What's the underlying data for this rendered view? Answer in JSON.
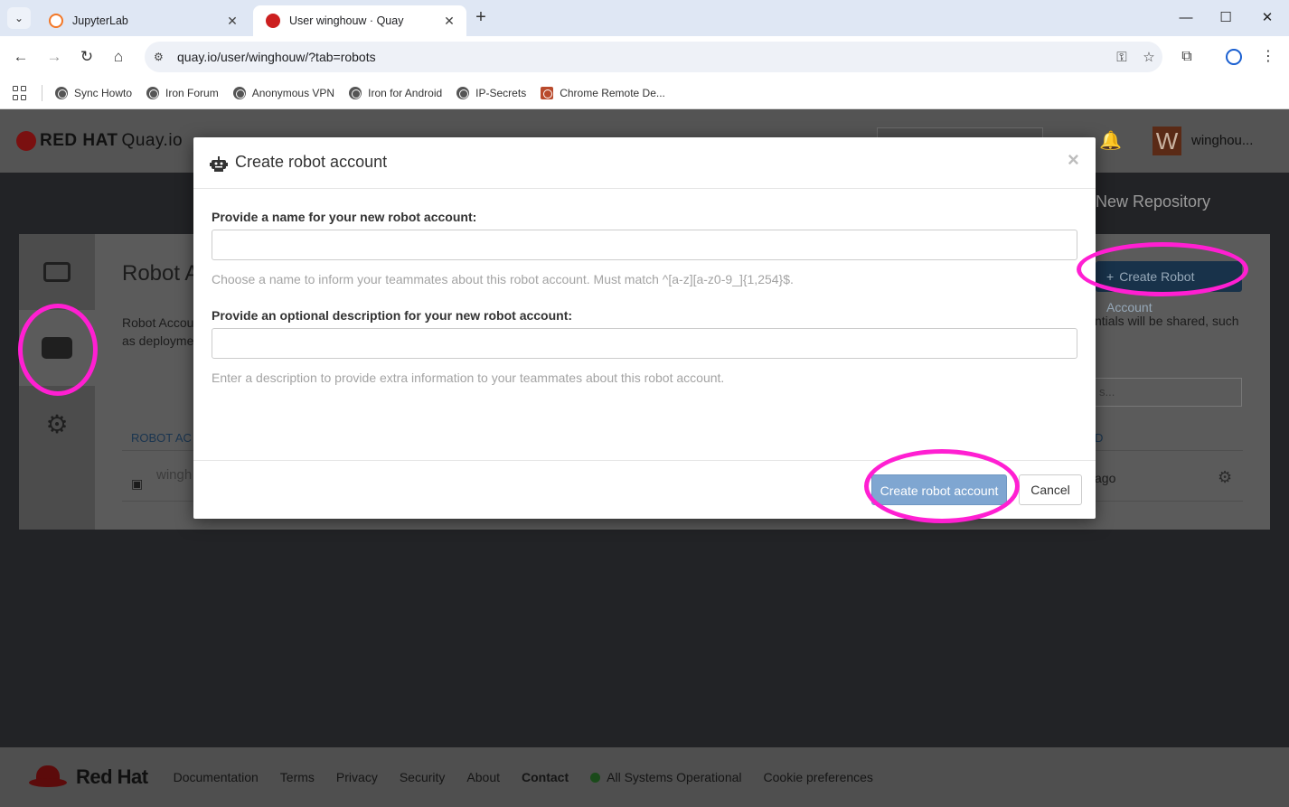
{
  "browser": {
    "tabs": [
      {
        "title": "JupyterLab",
        "active": false,
        "favicon_color": "#f37726"
      },
      {
        "title": "User winghouw · Quay",
        "active": true,
        "favicon_color": "#cc1f1f"
      }
    ],
    "url": "quay.io/user/winghouw/?tab=robots",
    "bookmarks": [
      "Sync Howto",
      "Iron Forum",
      "Anonymous VPN",
      "Iron for Android",
      "IP-Secrets",
      "Chrome Remote De..."
    ]
  },
  "quay": {
    "brand": "RED HAT",
    "product": "Quay.io",
    "avatar_letter": "W",
    "username": "winghou...",
    "new_repository": "New Repository",
    "page_title": "Robot A",
    "description_left": "Robot Accou as deployme",
    "description_right": "ntials will be shared, such",
    "create_robot_account_button": "Create Robot Account",
    "filter_placeholder": "s...",
    "table": {
      "col_left": "ROBOT AC",
      "col_right": "D",
      "row_name": "wingh",
      "row_time": "ago"
    },
    "footer": {
      "brand": "Red Hat",
      "links": [
        "Documentation",
        "Terms",
        "Privacy",
        "Security",
        "About",
        "Contact"
      ],
      "status": "All Systems Operational",
      "cookie": "Cookie preferences"
    }
  },
  "modal": {
    "title": "Create robot account",
    "close": "×",
    "name_label": "Provide a name for your new robot account:",
    "name_value": "",
    "name_help": "Choose a name to inform your teammates about this robot account. Must match ^[a-z][a-z0-9_]{1,254}$.",
    "desc_label": "Provide an optional description for your new robot account:",
    "desc_value": "",
    "desc_help": "Enter a description to provide extra information to your teammates about this robot account.",
    "create_button": "Create robot account",
    "cancel_button": "Cancel"
  },
  "colors": {
    "annotation": "#ff1fd2",
    "primary_button": "#7fa6d1",
    "quay_create_button": "#18324a"
  }
}
